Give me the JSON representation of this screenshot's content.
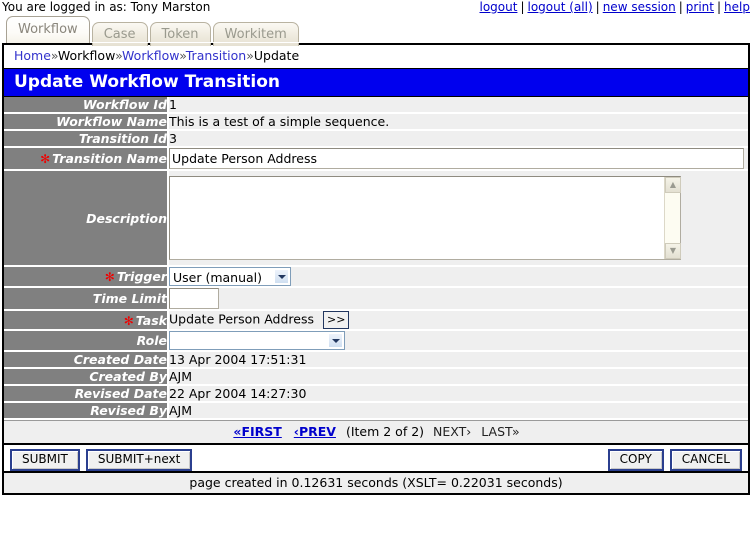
{
  "topbar": {
    "logged_in_text": "You are logged in as: Tony Marston",
    "links": [
      {
        "label": "logout"
      },
      {
        "label": "logout (all)"
      },
      {
        "label": "new session"
      },
      {
        "label": "print"
      },
      {
        "label": "help"
      }
    ],
    "separator": "|"
  },
  "tabs": [
    {
      "label": "Workflow",
      "active": true
    },
    {
      "label": "Case",
      "active": false
    },
    {
      "label": "Token",
      "active": false
    },
    {
      "label": "Workitem",
      "active": false
    }
  ],
  "breadcrumb": {
    "separator": "»",
    "items": [
      {
        "label": "Home",
        "link": true
      },
      {
        "label": "Workflow",
        "link": false
      },
      {
        "label": "Workflow",
        "link": true
      },
      {
        "label": "Transition",
        "link": true
      },
      {
        "label": "Update",
        "link": false
      }
    ]
  },
  "page_title": "Update Workflow Transition",
  "form": {
    "required_marker": "✻",
    "rows": [
      {
        "label": "Workflow Id",
        "required": false,
        "type": "text",
        "value": "1"
      },
      {
        "label": "Workflow Name",
        "required": false,
        "type": "text",
        "value": "This is a test of a simple sequence."
      },
      {
        "label": "Transition Id",
        "required": false,
        "type": "text",
        "value": "3"
      },
      {
        "label": "Transition Name",
        "required": true,
        "type": "input",
        "value": "Update Person Address",
        "placeholder": ""
      },
      {
        "label": "Description",
        "required": false,
        "type": "textarea",
        "value": "",
        "placeholder": ""
      },
      {
        "label": "Trigger",
        "required": true,
        "type": "select",
        "value": "User (manual)"
      },
      {
        "label": "Time Limit",
        "required": false,
        "type": "input-small",
        "value": "",
        "placeholder": ""
      },
      {
        "label": "Task",
        "required": true,
        "type": "text-with-button",
        "value": "Update Person Address",
        "button_label": ">>"
      },
      {
        "label": "Role",
        "required": false,
        "type": "select-wide",
        "value": ""
      },
      {
        "label": "Created Date",
        "required": false,
        "type": "text",
        "value": "13 Apr 2004 17:51:31"
      },
      {
        "label": "Created By",
        "required": false,
        "type": "text",
        "value": "AJM"
      },
      {
        "label": "Revised Date",
        "required": false,
        "type": "text",
        "value": "22 Apr 2004 14:27:30"
      },
      {
        "label": "Revised By",
        "required": false,
        "type": "text",
        "value": "AJM"
      }
    ]
  },
  "navigation": {
    "first": "«FIRST",
    "prev": "‹PREV",
    "item_counter": "(Item 2 of 2)",
    "next": "NEXT›",
    "last": "LAST»"
  },
  "buttons": {
    "submit": "SUBMIT",
    "submit_next": "SUBMIT+next",
    "copy": "COPY",
    "cancel": "CANCEL"
  },
  "footer": "page created in 0.12631 seconds (XSLT= 0.22031 seconds)",
  "colors": {
    "title_bar": "#0000ee",
    "label_cell": "#808080",
    "value_cell": "#efefef",
    "link": "#0000cc",
    "required": "#ee0000",
    "button_border": "#2b3f8f"
  }
}
